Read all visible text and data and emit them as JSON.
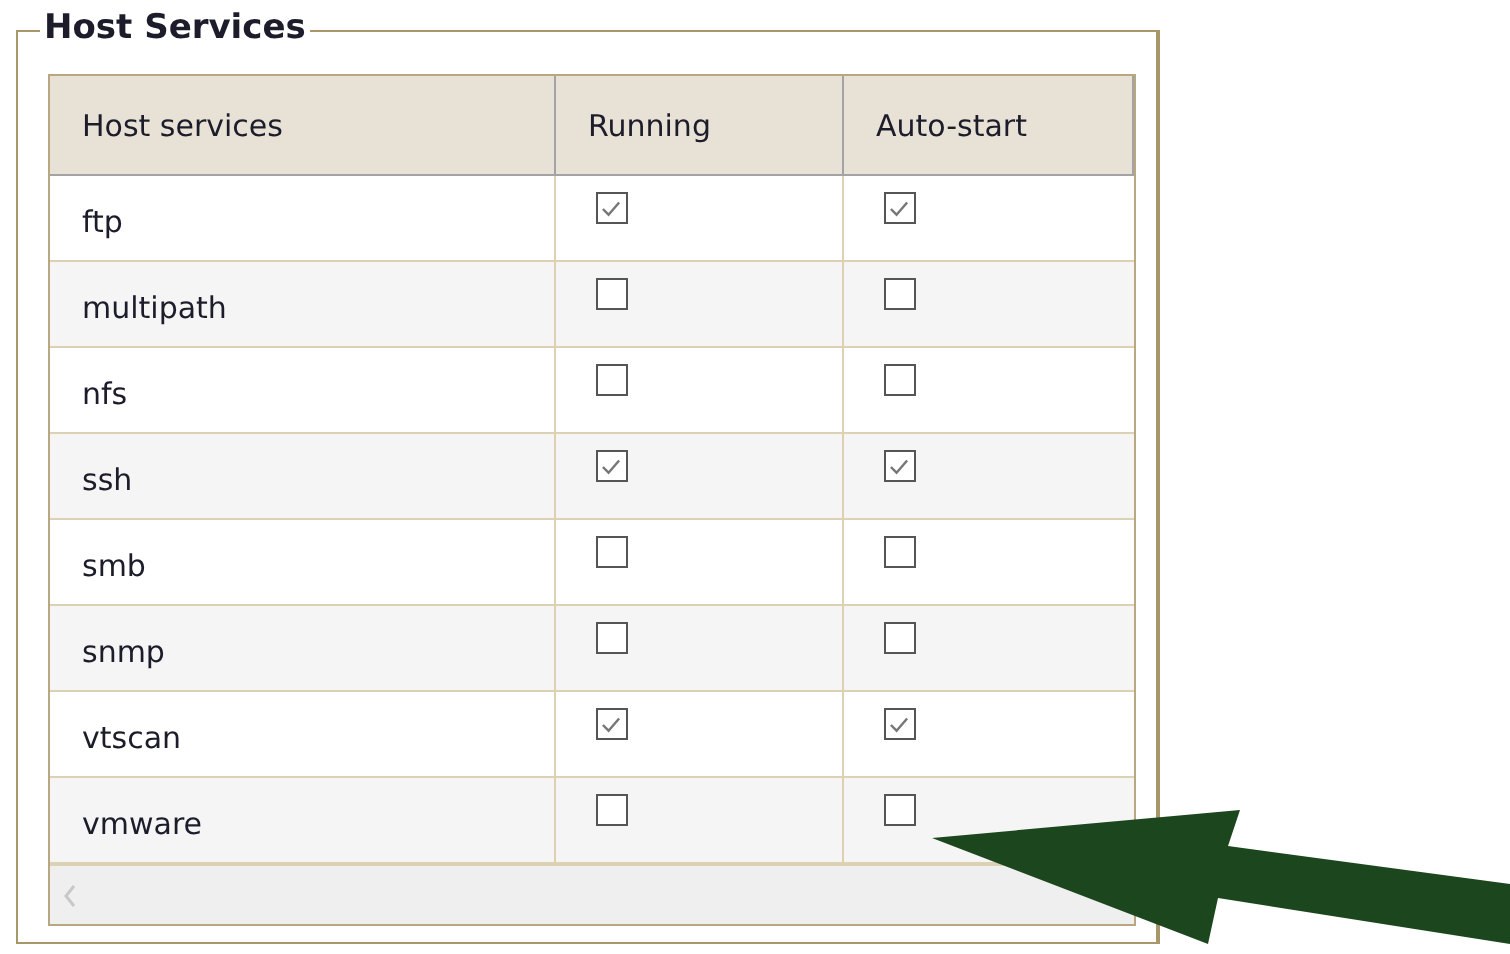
{
  "group": {
    "title": "Host Services"
  },
  "table": {
    "columns": [
      "Host services",
      "Running",
      "Auto-start"
    ],
    "rows": [
      {
        "service": "ftp",
        "running": true,
        "auto_start": true
      },
      {
        "service": "multipath",
        "running": false,
        "auto_start": false
      },
      {
        "service": "nfs",
        "running": false,
        "auto_start": false
      },
      {
        "service": "ssh",
        "running": true,
        "auto_start": true
      },
      {
        "service": "smb",
        "running": false,
        "auto_start": false
      },
      {
        "service": "snmp",
        "running": false,
        "auto_start": false
      },
      {
        "service": "vtscan",
        "running": true,
        "auto_start": true
      },
      {
        "service": "vmware",
        "running": false,
        "auto_start": false
      }
    ]
  }
}
